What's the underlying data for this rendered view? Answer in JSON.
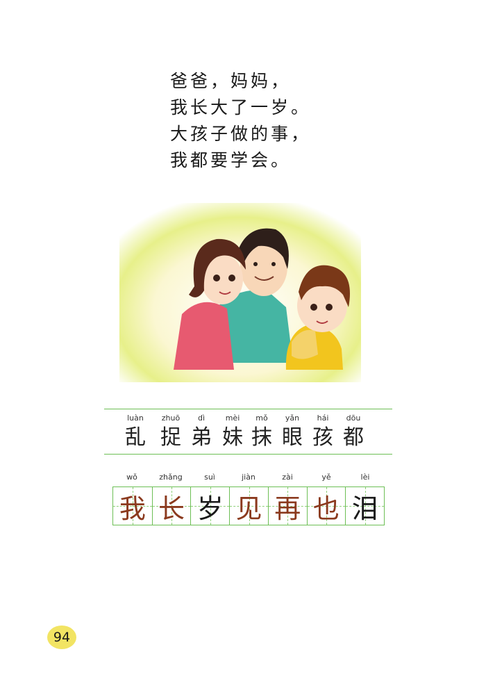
{
  "poem": {
    "lines": [
      "爸爸，妈妈，",
      "我长大了一岁。",
      "大孩子做的事，",
      "我都要学会。"
    ]
  },
  "colors": {
    "rule_green": "#6dbf55",
    "written_brown": "#8b3a1e",
    "written_black": "#1a1a1a",
    "page_badge": "#f2e463"
  },
  "reading": {
    "items": [
      {
        "pinyin": "luàn",
        "char": "乱"
      },
      {
        "pinyin": "zhuō",
        "char": "捉"
      },
      {
        "pinyin": "dì",
        "char": "弟"
      },
      {
        "pinyin": "mèi",
        "char": "妹"
      },
      {
        "pinyin": "mǒ",
        "char": "抹"
      },
      {
        "pinyin": "yǎn",
        "char": "眼"
      },
      {
        "pinyin": "hái",
        "char": "孩"
      },
      {
        "pinyin": "dōu",
        "char": "都"
      }
    ]
  },
  "writing": {
    "items": [
      {
        "pinyin": "wǒ",
        "char": "我",
        "color": "#8b3a1e"
      },
      {
        "pinyin": "zhǎng",
        "char": "长",
        "color": "#8b3a1e"
      },
      {
        "pinyin": "suì",
        "char": "岁",
        "color": "#1a1a1a"
      },
      {
        "pinyin": "jiàn",
        "char": "见",
        "color": "#8b3a1e"
      },
      {
        "pinyin": "zài",
        "char": "再",
        "color": "#8b3a1e"
      },
      {
        "pinyin": "yě",
        "char": "也",
        "color": "#8b3a1e"
      },
      {
        "pinyin": "lèi",
        "char": "泪",
        "color": "#1a1a1a"
      }
    ]
  },
  "page_number": "94"
}
